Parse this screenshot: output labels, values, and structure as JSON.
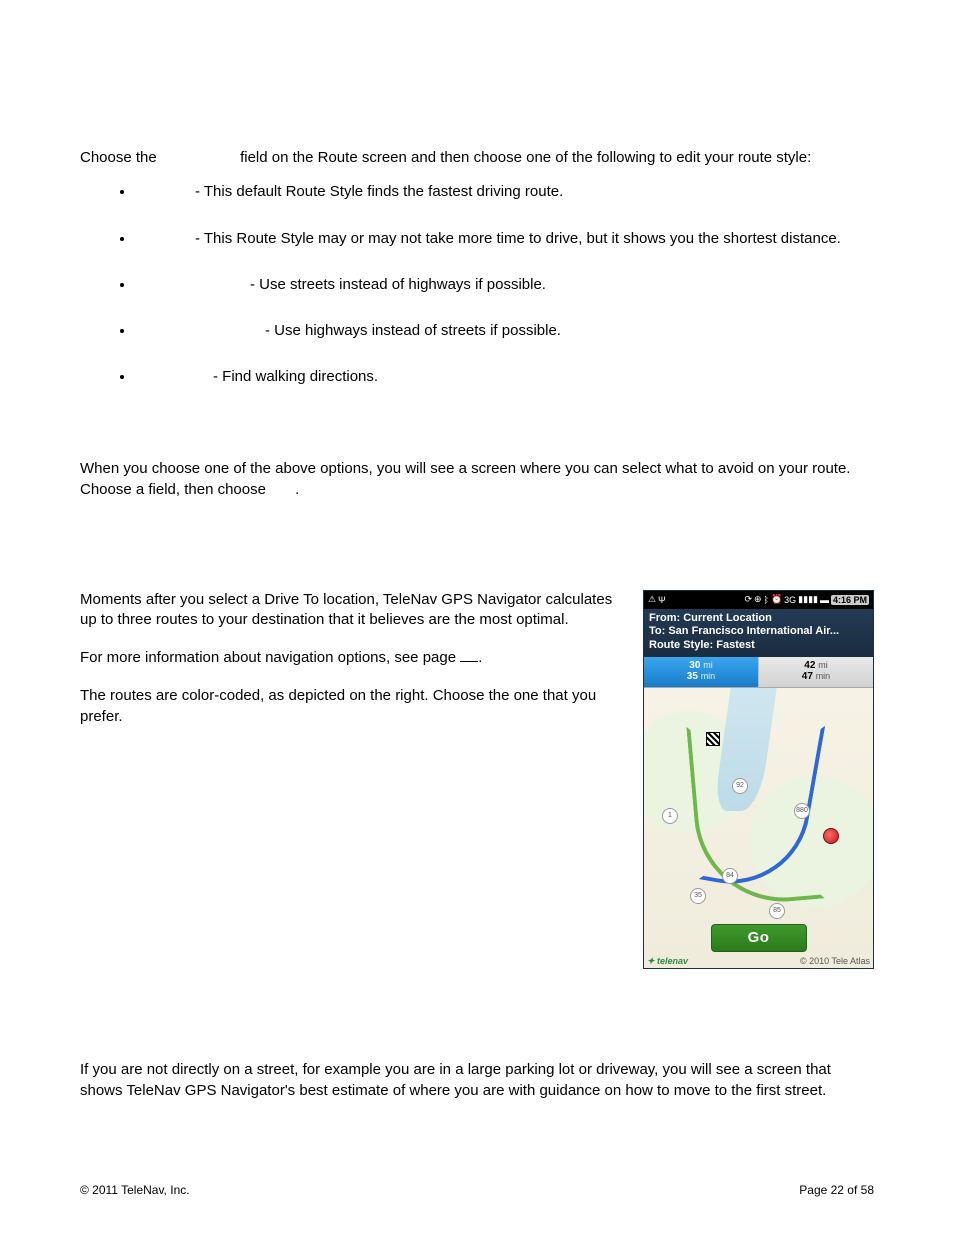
{
  "intro_pre": "Choose the ",
  "intro_post": " field on the Route screen and then choose one of the following to edit your route style:",
  "bullets": [
    " - This default Route Style finds the fastest driving route.",
    " - This Route Style may or may not take more time to drive, but it shows you the shortest distance.",
    " - Use streets instead of highways if possible.",
    " - Use highways instead of streets if possible.",
    " - Find walking directions."
  ],
  "avoid_line1": "When you choose one of the above options, you will see a screen where you can select what to avoid on your route.",
  "avoid_line2_pre": "Choose a field, then choose ",
  "avoid_line2_post": ".",
  "cmp_p1": "Moments after you select a Drive To location, TeleNav GPS Navigator calculates up to three routes to your destination that it believes are the most optimal.",
  "cmp_p2_pre": "For more information about navigation options, see page ",
  "cmp_p2_link": " ",
  "cmp_p2_post": ".",
  "cmp_p3": "The routes are color-coded, as depicted on the right. Choose the one that you prefer.",
  "initial_guidance": "If you are not directly on a street, for example you are in a large parking lot or driveway, you will see a screen that shows TeleNav GPS Navigator's best estimate of where you are with guidance on how to move to the first street.",
  "footer_left": "© 2011 TeleNav, Inc.",
  "footer_right": "Page 22 of 58",
  "device": {
    "time": "4:16 PM",
    "from_prefix": "From: ",
    "from_value": "Current Location",
    "to_prefix": "To: ",
    "to_value": "San Francisco International Air...",
    "style_prefix": "Route Style: ",
    "style_value": "Fastest",
    "tab1_dist": "30",
    "tab1_dist_unit": "mi",
    "tab1_time": "35",
    "tab1_time_unit": "min",
    "tab2_dist": "42",
    "tab2_dist_unit": "mi",
    "tab2_time": "47",
    "tab2_time_unit": "min",
    "go": "Go",
    "brand": "telenav",
    "copyright": "© 2010 Tele Atlas"
  }
}
